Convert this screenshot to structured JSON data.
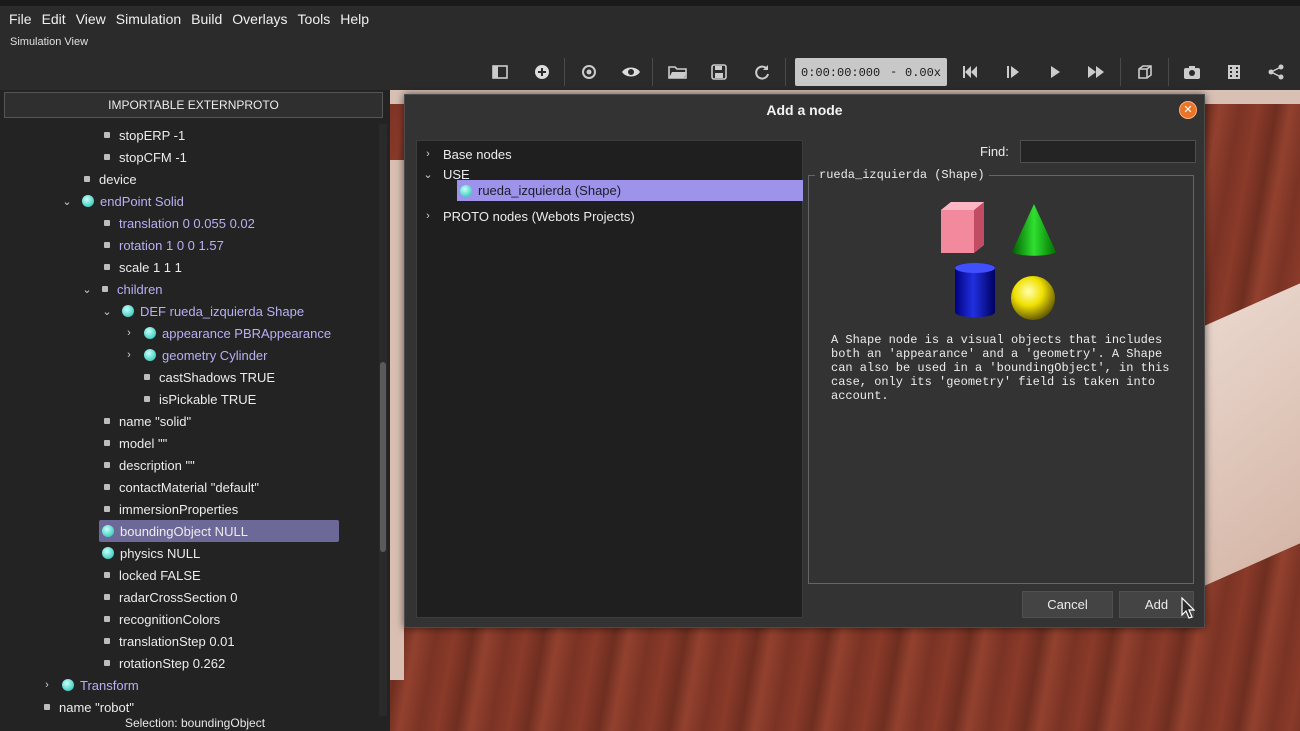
{
  "menubar": {
    "items": [
      "File",
      "Edit",
      "View",
      "Simulation",
      "Build",
      "Overlays",
      "Tools",
      "Help"
    ]
  },
  "view_label": "Simulation View",
  "toolbar": {
    "time": "0:00:00:000",
    "dash": "-",
    "speed": "0.00x",
    "icons": [
      "panel-toggle-icon",
      "add-node-icon",
      "revert-icon",
      "eye-icon",
      "open-world-icon",
      "save-world-icon",
      "reload-icon",
      "step-back-icon",
      "step-icon",
      "run-icon",
      "fast-forward-icon",
      "perspective-icon",
      "screenshot-icon",
      "record-movie-icon",
      "share-icon"
    ]
  },
  "left_panel": {
    "extern_button": "IMPORTABLE EXTERNPROTO",
    "status": "Selection: boundingObject",
    "tree": [
      {
        "label": "stopERP -1",
        "color": "white",
        "marker": "dot"
      },
      {
        "label": "stopCFM -1",
        "color": "white",
        "marker": "dot"
      },
      {
        "label": "device",
        "color": "white",
        "marker": "dot"
      },
      {
        "label": "endPoint Solid",
        "color": "purple",
        "marker": "ball",
        "chevron": "down"
      },
      {
        "label": "translation 0 0.055 0.02",
        "color": "purple",
        "marker": "dot"
      },
      {
        "label": "rotation 1 0 0 1.57",
        "color": "purple",
        "marker": "dot"
      },
      {
        "label": "scale 1 1 1",
        "color": "white",
        "marker": "dot"
      },
      {
        "label": "children",
        "color": "purple",
        "marker": "dot",
        "chevron": "down"
      },
      {
        "label": "DEF rueda_izquierda Shape",
        "color": "purple",
        "marker": "ball",
        "chevron": "down"
      },
      {
        "label": "appearance PBRAppearance",
        "color": "purple",
        "marker": "ball",
        "chevron": "right"
      },
      {
        "label": "geometry Cylinder",
        "color": "purple",
        "marker": "ball",
        "chevron": "right"
      },
      {
        "label": "castShadows TRUE",
        "color": "white",
        "marker": "dot"
      },
      {
        "label": "isPickable TRUE",
        "color": "white",
        "marker": "dot"
      },
      {
        "label": "name \"solid\"",
        "color": "white",
        "marker": "dot"
      },
      {
        "label": "model \"\"",
        "color": "white",
        "marker": "dot"
      },
      {
        "label": "description \"\"",
        "color": "white",
        "marker": "dot"
      },
      {
        "label": "contactMaterial \"default\"",
        "color": "white",
        "marker": "dot"
      },
      {
        "label": "immersionProperties",
        "color": "white",
        "marker": "dot"
      },
      {
        "label": "boundingObject NULL",
        "color": "white",
        "marker": "ball",
        "selected": true
      },
      {
        "label": "physics NULL",
        "color": "white",
        "marker": "ball"
      },
      {
        "label": "locked FALSE",
        "color": "white",
        "marker": "dot"
      },
      {
        "label": "radarCrossSection 0",
        "color": "white",
        "marker": "dot"
      },
      {
        "label": "recognitionColors",
        "color": "white",
        "marker": "dot"
      },
      {
        "label": "translationStep 0.01",
        "color": "white",
        "marker": "dot"
      },
      {
        "label": "rotationStep 0.262",
        "color": "white",
        "marker": "dot"
      },
      {
        "label": "Transform",
        "color": "purple",
        "marker": "ball",
        "chevron": "right"
      },
      {
        "label": "name \"robot\"",
        "color": "white",
        "marker": "dot"
      }
    ]
  },
  "dialog": {
    "title": "Add a node",
    "close_symbol": "✕",
    "tree": [
      {
        "label": "Base nodes",
        "chevron": "right"
      },
      {
        "label": "USE",
        "chevron": "down"
      },
      {
        "label": "rueda_izquierda (Shape)",
        "selected": true
      },
      {
        "label": "PROTO nodes (Webots Projects)",
        "chevron": "right"
      }
    ],
    "find_label": "Find:",
    "find_value": "",
    "info_title": "rueda_izquierda (Shape)",
    "description": "A Shape node is a visual objects that includes both an 'appearance' and a 'geometry'. A Shape can also be used in a 'boundingObject', in this case, only its 'geometry' field is taken into account.",
    "cancel_label": "Cancel",
    "add_label": "Add"
  },
  "colors": {
    "purple_text": "#b7b0f5",
    "selection": "#6c6897",
    "dialog_selection": "#9d93ea",
    "close_button": "#e8752a"
  }
}
